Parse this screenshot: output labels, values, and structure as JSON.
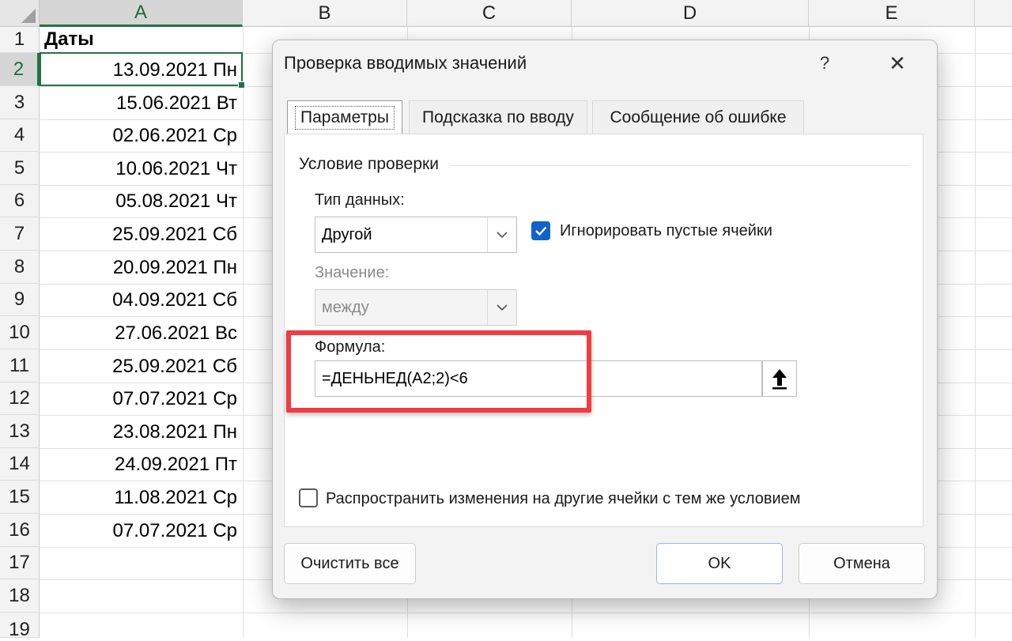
{
  "spreadsheet": {
    "columns": [
      "A",
      "B",
      "C",
      "D",
      "E"
    ],
    "selected_column": "A",
    "rows": [
      "1",
      "2",
      "3",
      "4",
      "5",
      "6",
      "7",
      "8",
      "9",
      "10",
      "11",
      "12",
      "13",
      "14",
      "15",
      "16",
      "17",
      "18",
      "19"
    ],
    "selected_row": "2",
    "header_cell": "Даты",
    "dates": [
      "13.09.2021 Пн",
      "15.06.2021 Вт",
      "02.06.2021 Ср",
      "10.06.2021 Чт",
      "05.08.2021 Чт",
      "25.09.2021 Сб",
      "20.09.2021 Пн",
      "04.09.2021 Сб",
      "27.06.2021 Вс",
      "25.09.2021 Сб",
      "07.07.2021 Ср",
      "23.08.2021 Пн",
      "24.09.2021 Пт",
      "11.08.2021 Ср",
      "07.07.2021 Ср"
    ],
    "accent_color": "#217346"
  },
  "dialog": {
    "title": "Проверка вводимых значений",
    "help_label": "?",
    "close_label": "✕",
    "tabs": [
      {
        "label": "Параметры",
        "active": true
      },
      {
        "label": "Подсказка по вводу",
        "active": false
      },
      {
        "label": "Сообщение об ошибке",
        "active": false
      }
    ],
    "group_title": "Условие проверки",
    "data_type": {
      "label": "Тип данных:",
      "value": "Другой"
    },
    "ignore_blank": {
      "label": "Игнорировать пустые ячейки",
      "checked": true
    },
    "value_field": {
      "label": "Значение:",
      "value": "между",
      "disabled": true
    },
    "formula": {
      "label": "Формула:",
      "value": "=ДЕНЬНЕД(A2;2)<6"
    },
    "apply_all": {
      "label": "Распространить изменения на другие ячейки с тем же условием",
      "checked": false
    },
    "buttons": {
      "clear_all": "Очистить все",
      "ok": "OK",
      "cancel": "Отмена"
    },
    "highlight_color": "#f23b43",
    "checkbox_color": "#0f63c9"
  }
}
